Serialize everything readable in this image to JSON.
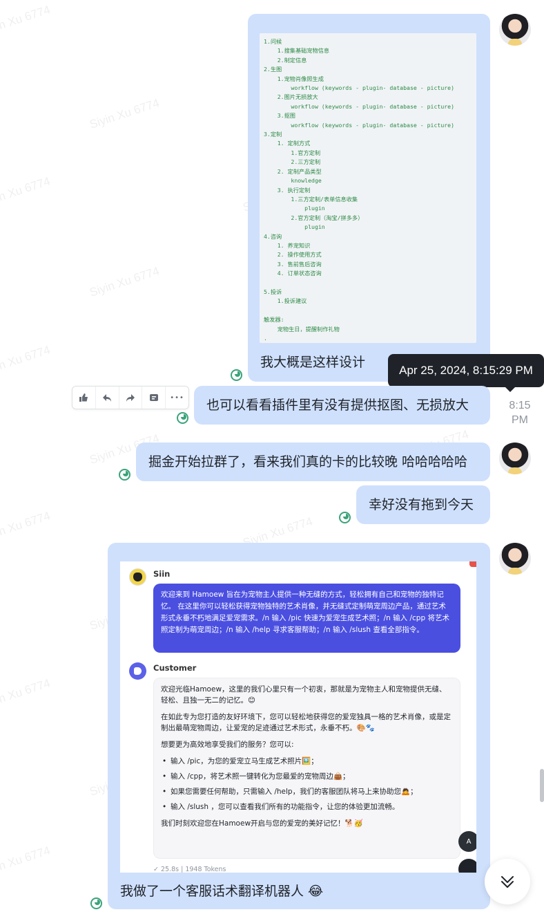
{
  "watermark": "Siyin Xu 6774",
  "code_lines": [
    "1.问候",
    "    1.搜集基础宠物信息",
    "    2.制定信息",
    "2.生图",
    "    1.宠物肖像照生成",
    "        workflow (keywords - plugin- database - picture)",
    "    2.图片无损放大",
    "        workflow (keywords - plugin- database - picture)",
    "    3.抠图",
    "        workflow (keywords - plugin- database - picture)",
    "3.定制",
    "    1. 定制方式",
    "        1.官方定制",
    "        2.三方定制",
    "    2. 定制产品类型",
    "        knowledge",
    "    3. 执行定制",
    "        1.三方定制/表单信息收集",
    "            plugin",
    "        2.官方定制（淘宝/拼多多）",
    "            plugin",
    "4.咨询",
    "    1. 养宠知识",
    "    2. 操作使用方式",
    "    3. 售前售后咨询",
    "    4. 订单状态咨询",
    "",
    "5.投诉",
    "    1.投诉建议",
    "",
    "触发器:",
    "    宠物生日，提醒制作礼物",
    "."
  ],
  "messages": {
    "m1_text": "我大概是这样设计",
    "m2_text": "也可以看看插件里有没有提供抠图、无损放大",
    "m3_text": "掘金开始拉群了，看来我们真的卡的比较晚 哈哈哈哈哈",
    "m4_text": "幸好没有拖到今天",
    "m5_text": "我做了一个客服话术翻译机器人 😂"
  },
  "tooltip": "Apr 25, 2024, 8:15:29 PM",
  "timestamp_line1": "8:15",
  "timestamp_line2": "PM",
  "toolbar": {
    "icons": [
      "thumbs-up-icon",
      "reply-icon",
      "forward-icon",
      "quote-icon",
      "more-icon"
    ],
    "more_label": "•••"
  },
  "embedded": {
    "bot_name": "Siin",
    "bot_message": "欢迎来到 Hamoew 旨在为宠物主人提供一种无缝的方式，轻松拥有自己和宠物的独特记忆。 在这里你可以轻松获得宠物独特的艺术肖像，并无缝式定制萌宠周边产品，通过艺术形式永垂不朽地满足爱宠需求。/n 输入 /pic 快速为爱宠生成艺术照；/n 输入 /cpp 将艺术照定制为萌宠周边；/n 输入 /help 寻求客服帮助；/n 输入 /slush 查看全部指令。",
    "customer_name": "Customer",
    "customer_p1": "欢迎光临Hamoew，这里的我们心里只有一个初衷，那就是为宠物主人和宠物提供无缝、轻松、且独一无二的记忆。😊",
    "customer_p2": "在如此专为您打造的友好环境下，您可以轻松地获得您的爱宠独具一格的艺术肖像，或是定制出最萌宠物周边，让爱宠的足迹通过艺术形式，永垂不朽。🎨🐾",
    "customer_p3": "想要更为高效地享受我们的服务？您可以:",
    "bullets": [
      "输入 /pic，为您的爱宠立马生成艺术照片🖼️；",
      "输入 /cpp，将艺术照一键转化为您最爱的宠物周边👜；",
      "如果您需要任何帮助，只需输入 /help，我们的客服团队将马上来协助您🙇；",
      "输入 /slush ，您可以查看我们所有的功能指令，让您的体验更加流畅。"
    ],
    "customer_p4": "我们时刻欢迎您在Hamoew开启与您的爱宠的美好记忆！🐕🥳",
    "meta": "✓ 25.8s  |  1948 Tokens"
  },
  "colors": {
    "bubble": "#cfe0fd",
    "bot_bubble": "#4a4fe0",
    "code_text": "#2d8a45",
    "read_icon": "#3aa37a"
  }
}
